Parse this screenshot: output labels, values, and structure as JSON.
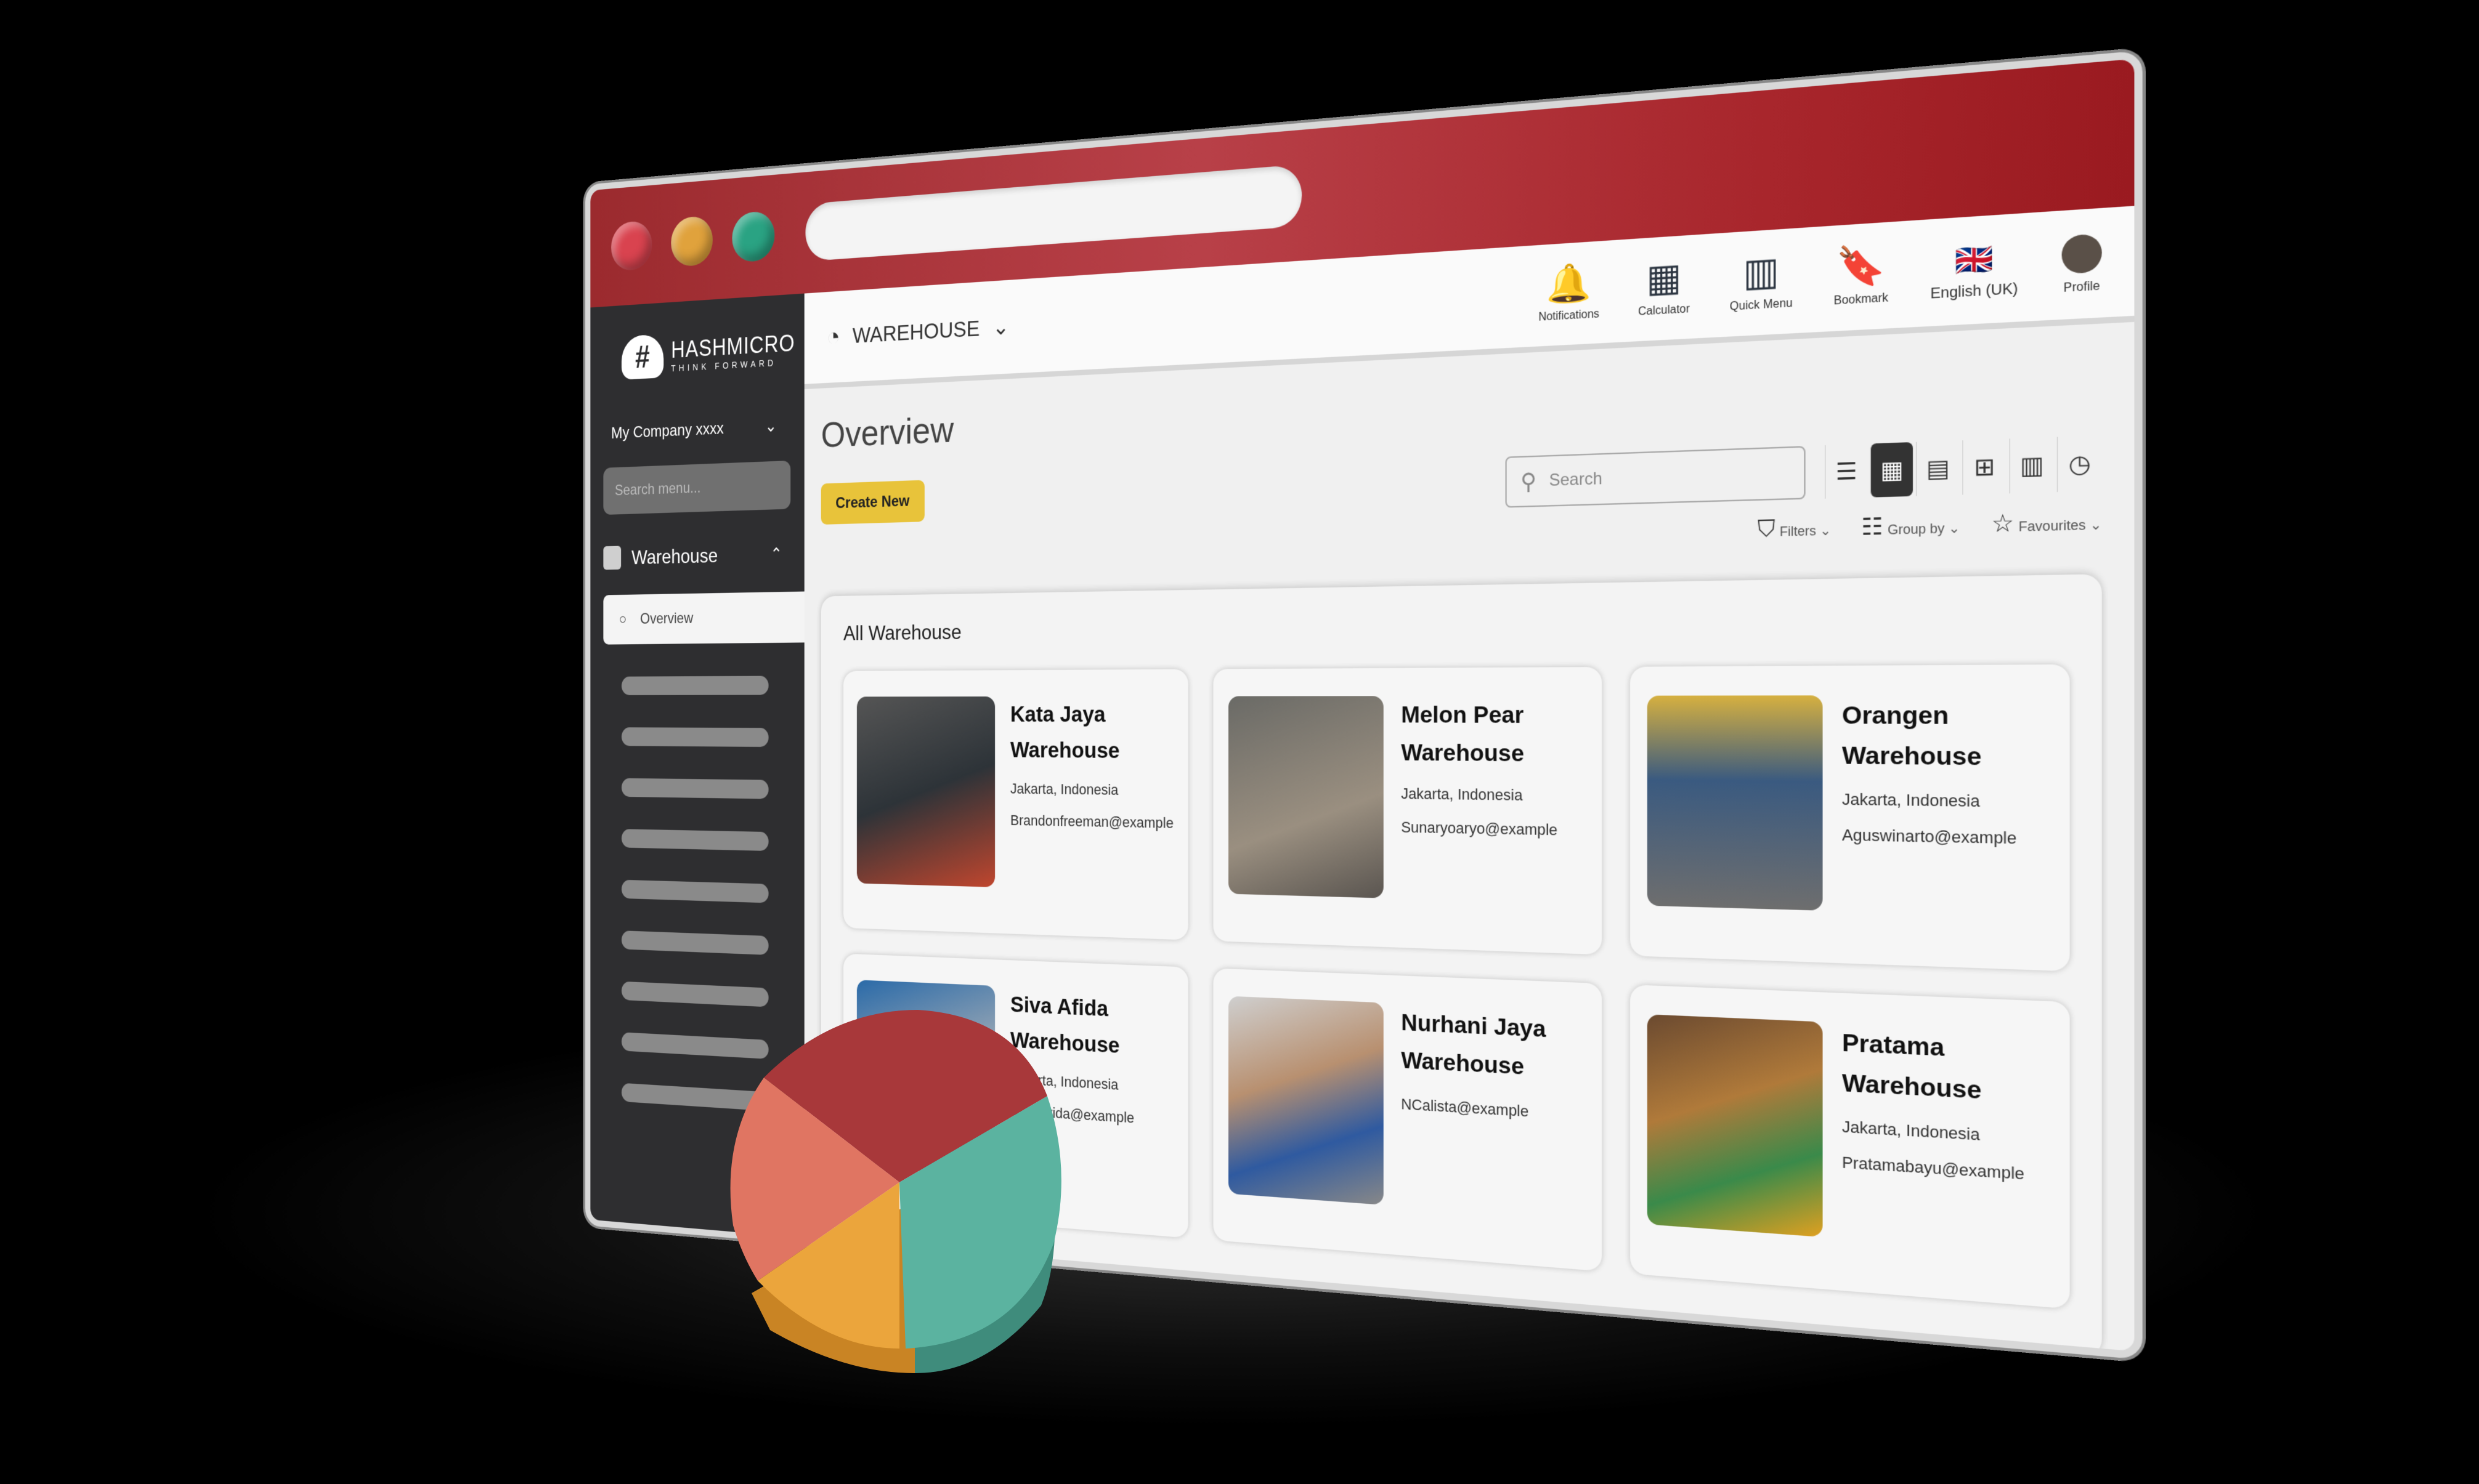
{
  "browser": {
    "lights": [
      "#d9434f",
      "#e0a23c",
      "#2aa383"
    ]
  },
  "sidebar": {
    "logo_title": "HASHMICRO",
    "logo_tagline": "THINK FORWARD",
    "company": "My Company xxxx",
    "search_placeholder": "Search menu...",
    "group": "Warehouse",
    "active_item": "Overview",
    "placeholder_count": 9
  },
  "header": {
    "module": "WAREHOUSE",
    "icons": [
      {
        "name": "bell-icon",
        "label": "Notifications",
        "glyph": "🔔"
      },
      {
        "name": "calculator-icon",
        "label": "Calculator",
        "glyph": "▦"
      },
      {
        "name": "quick-menu-icon",
        "label": "Quick Menu",
        "glyph": "▥"
      },
      {
        "name": "bookmark-icon",
        "label": "Bookmark",
        "glyph": "🔖"
      }
    ],
    "language": "English (UK)",
    "profile": "Profile"
  },
  "main": {
    "title": "Overview",
    "create_label": "Create New",
    "search_placeholder": "Search",
    "filters": "Filters",
    "group_by": "Group by",
    "favourites": "Favourites",
    "panel_title": "All Warehouse",
    "cards": [
      {
        "name": "Kata Jaya Warehouse",
        "location": "Jakarta, Indonesia",
        "email": "Brandonfreeman@example"
      },
      {
        "name": "Melon Pear Warehouse",
        "location": "Jakarta, Indonesia",
        "email": "Sunaryoaryo@example"
      },
      {
        "name": "Orangen Warehouse",
        "location": "Jakarta, Indonesia",
        "email": "Aguswinarto@example"
      },
      {
        "name": "Siva Afida Warehouse",
        "location": "Jakarta, Indonesia",
        "email": "Sivalavida@example"
      },
      {
        "name": "Nurhani Jaya Warehouse",
        "location": "",
        "email": "NCalista@example"
      },
      {
        "name": "Pratama Warehouse",
        "location": "Jakarta, Indonesia",
        "email": "Pratamabayu@example"
      }
    ]
  },
  "accent": {
    "titlebar": "#a8262c",
    "create": "#e8c33a"
  },
  "pie_colors": [
    "#a8383a",
    "#e07562",
    "#eba53c",
    "#5bb3a0"
  ]
}
